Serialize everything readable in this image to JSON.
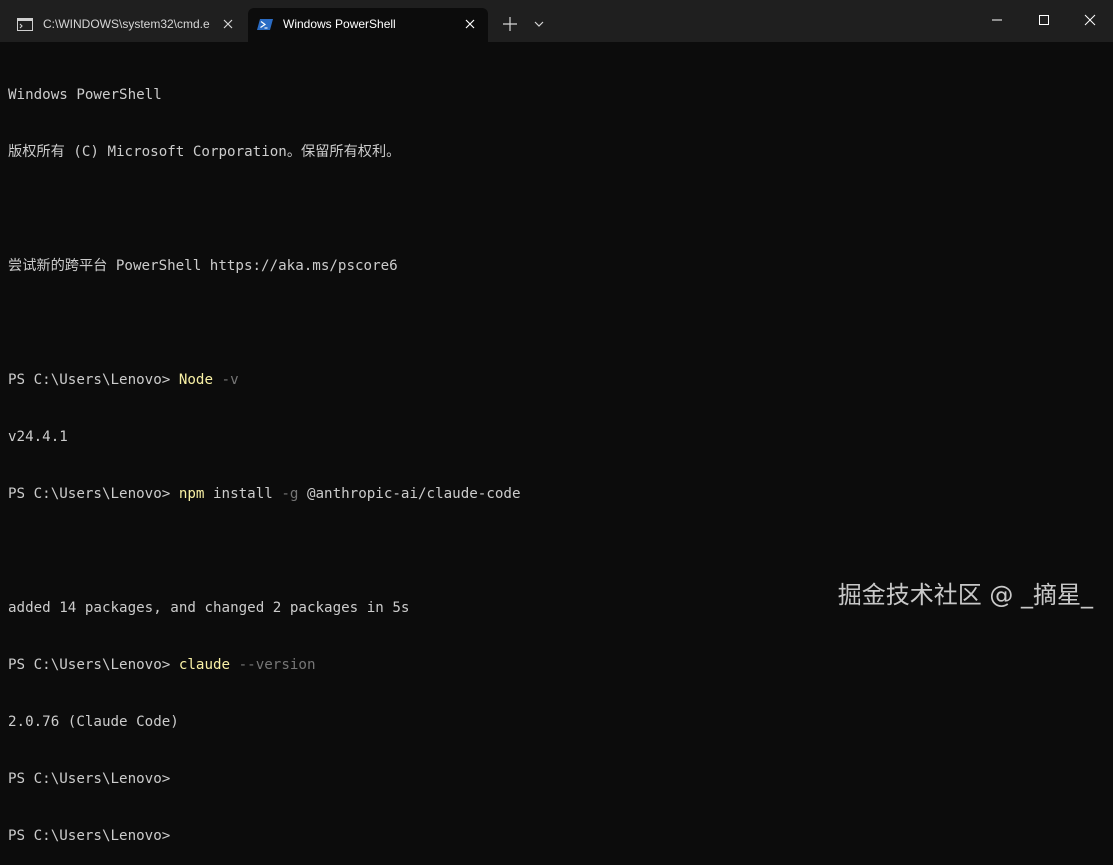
{
  "tabs": [
    {
      "label": "C:\\WINDOWS\\system32\\cmd.e",
      "icon": "cmd-icon",
      "active": false
    },
    {
      "label": "Windows PowerShell",
      "icon": "powershell-icon",
      "active": true
    }
  ],
  "titlebar": {
    "new_tab": "+",
    "dropdown": "chevron-down-icon"
  },
  "colors": {
    "background": "#0c0c0c",
    "titlebar": "#1f1f1f",
    "text": "#cccccc",
    "command": "#f9f1a5",
    "parameter": "#767676"
  },
  "console": {
    "lines": [
      "Windows PowerShell",
      "版权所有 (C) Microsoft Corporation。保留所有权利。",
      "",
      "尝试新的跨平台 PowerShell https://aka.ms/pscore6",
      "",
      {
        "prompt": "PS C:\\Users\\Lenovo> ",
        "cmd": "Node",
        "flag": " -v",
        "rest": ""
      },
      "v24.4.1",
      {
        "prompt": "PS C:\\Users\\Lenovo> ",
        "cmd": "npm",
        "rest1": " install ",
        "flag": "-g",
        "rest": " @anthropic-ai/claude-code"
      },
      "",
      "added 14 packages, and changed 2 packages in 5s",
      {
        "prompt": "PS C:\\Users\\Lenovo> ",
        "cmd": "claude",
        "flag": " --version",
        "rest": ""
      },
      "2.0.76 (Claude Code)",
      "PS C:\\Users\\Lenovo>",
      "PS C:\\Users\\Lenovo>"
    ]
  },
  "watermark": "掘金技术社区 @ _摘星_"
}
